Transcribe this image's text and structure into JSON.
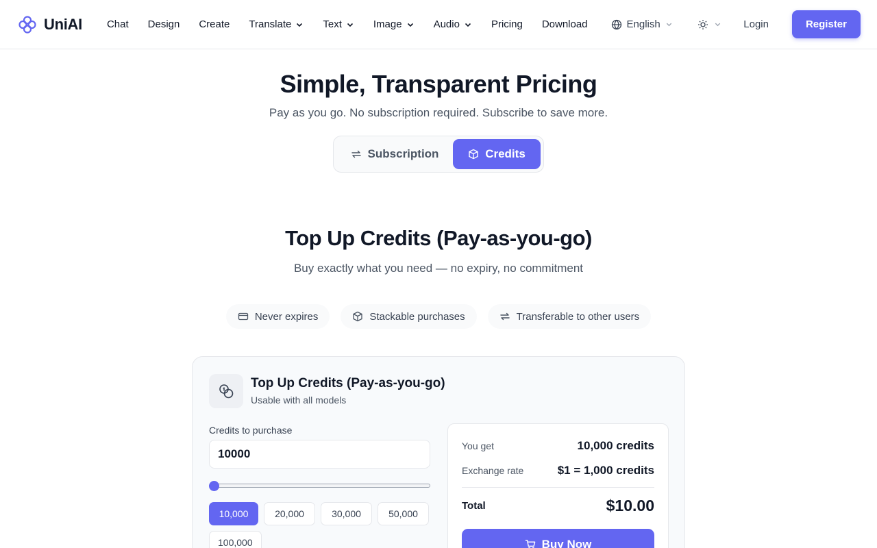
{
  "brand": {
    "name": "UniAI",
    "logo_icon": "clover-logo-icon",
    "accent": "#6366f1"
  },
  "nav": {
    "items": [
      {
        "label": "Chat",
        "dropdown": false
      },
      {
        "label": "Design",
        "dropdown": false
      },
      {
        "label": "Create",
        "dropdown": false
      },
      {
        "label": "Translate",
        "dropdown": true
      },
      {
        "label": "Text",
        "dropdown": true
      },
      {
        "label": "Image",
        "dropdown": true
      },
      {
        "label": "Audio",
        "dropdown": true
      },
      {
        "label": "Pricing",
        "dropdown": false
      },
      {
        "label": "Download",
        "dropdown": false
      }
    ],
    "language": "English",
    "language_icon": "globe-icon",
    "theme_icon": "sun-icon",
    "login_label": "Login",
    "register_label": "Register"
  },
  "hero": {
    "title": "Simple, Transparent Pricing",
    "subtitle": "Pay as you go. No subscription required. Subscribe to save more.",
    "toggle": {
      "subscription_label": "Subscription",
      "subscription_icon": "repeat-arrows-icon",
      "credits_label": "Credits",
      "credits_icon": "box-icon",
      "selected": "Credits"
    }
  },
  "credits_section": {
    "title": "Top Up Credits (Pay-as-you-go)",
    "subtitle": "Buy exactly what you need — no expiry, no commitment",
    "features": [
      {
        "label": "Never expires",
        "icon": "credit-card-icon"
      },
      {
        "label": "Stackable purchases",
        "icon": "box-icon"
      },
      {
        "label": "Transferable to other users",
        "icon": "repeat-arrows-icon"
      }
    ]
  },
  "card": {
    "title": "Top Up Credits (Pay-as-you-go)",
    "subtitle": "Usable with all models",
    "icon": "coins-icon",
    "input_label": "Credits to purchase",
    "input_value": "10000",
    "slider_fraction": 0,
    "presets": [
      "10,000",
      "20,000",
      "30,000",
      "50,000",
      "100,000"
    ],
    "active_preset": "10,000",
    "summary": {
      "you_get_label": "You get",
      "you_get_value": "10,000 credits",
      "rate_label": "Exchange rate",
      "rate_value": "$1 = 1,000 credits",
      "total_label": "Total",
      "total_value": "$10.00",
      "buy_label": "Buy Now",
      "buy_icon": "cart-icon"
    }
  }
}
